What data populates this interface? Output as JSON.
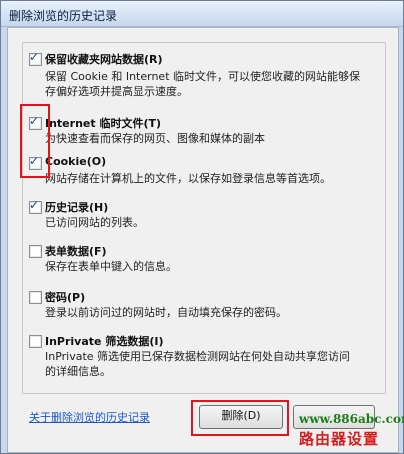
{
  "window": {
    "title": "删除浏览的历史记录"
  },
  "items": [
    {
      "label": "保留收藏夹网站数据(R)",
      "checked": true,
      "desc": [
        "保留 Cookie 和 Internet 临时文件，可以使您收藏的网站能够保",
        "存偏好选项并提高显示速度。"
      ]
    },
    {
      "label": "Internet 临时文件(T)",
      "checked": true,
      "desc": [
        "为快速查看而保存的网页、图像和媒体的副本"
      ]
    },
    {
      "label": "Cookie(O)",
      "checked": true,
      "desc": [
        "网站存储在计算机上的文件，以保存如登录信息等首选项。"
      ]
    },
    {
      "label": "历史记录(H)",
      "checked": true,
      "desc": [
        "已访问网站的列表。"
      ]
    },
    {
      "label": "表单数据(F)",
      "checked": false,
      "desc": [
        "保存在表单中键入的信息。"
      ]
    },
    {
      "label": "密码(P)",
      "checked": false,
      "desc": [
        "登录以前访问过的网站时，自动填充保存的密码。"
      ]
    },
    {
      "label": "InPrivate 筛选数据(I)",
      "checked": false,
      "desc": [
        "InPrivate 筛选使用已保存数据检测网站在何处自动共享您访问",
        "的详细信息。"
      ]
    }
  ],
  "check_mark": "✓",
  "footer": {
    "about_link": "关于删除浏览的历史记录",
    "delete_button": "删除(D)",
    "cancel_button": ""
  },
  "watermark": {
    "url": "www.886abc.com",
    "text": "路由器设置"
  }
}
